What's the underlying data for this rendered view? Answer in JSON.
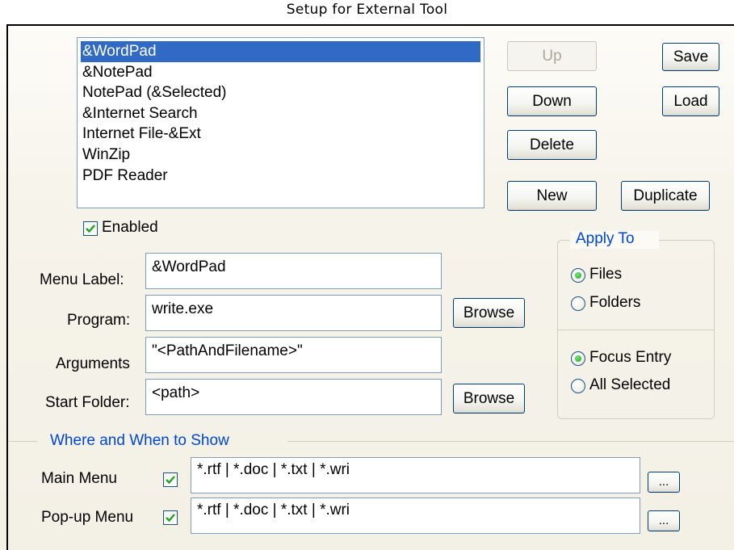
{
  "window": {
    "title": "Setup for External Tool"
  },
  "tools_list": {
    "selected_index": 0,
    "items": [
      "&WordPad",
      "&NotePad",
      "NotePad (&Selected)",
      "&Internet Search",
      "Internet File-&Ext",
      "WinZip",
      "PDF Reader"
    ]
  },
  "buttons": {
    "up": "Up",
    "down": "Down",
    "delete": "Delete",
    "new": "New",
    "duplicate": "Duplicate",
    "save": "Save",
    "load": "Load",
    "browse": "Browse",
    "ellipsis": "..."
  },
  "enabled": {
    "label": "Enabled",
    "checked": true
  },
  "fields": {
    "menu_label": {
      "label": "Menu Label:",
      "value": "&WordPad"
    },
    "program": {
      "label": "Program:",
      "value": "write.exe"
    },
    "arguments": {
      "label": "Arguments",
      "value": "\"<PathAndFilename>\""
    },
    "start_folder": {
      "label": "Start Folder:",
      "value": "<path>"
    }
  },
  "apply_to": {
    "title": "Apply To",
    "files": "Files",
    "folders": "Folders",
    "focus_entry": "Focus Entry",
    "all_selected": "All Selected",
    "selected_target": "files",
    "selected_scope": "focus_entry"
  },
  "where_when": {
    "title": "Where and When to Show",
    "main_menu": {
      "label": "Main Menu",
      "checked": true,
      "value": "*.rtf | *.doc | *.txt | *.wri"
    },
    "popup_menu": {
      "label": "Pop-up Menu",
      "checked": true,
      "value": "*.rtf | *.doc | *.txt | *.wri"
    }
  },
  "colors": {
    "selection": "#316ac5",
    "group_title": "#0046d5",
    "check_green": "#21a121"
  }
}
